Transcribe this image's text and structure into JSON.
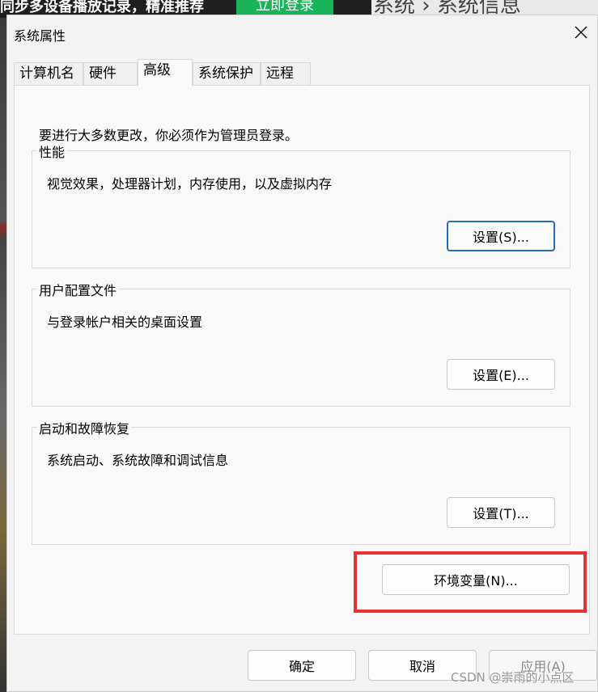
{
  "background": {
    "left_text": "同步多设备播放记录，精准推荐",
    "left_button": "立即登录",
    "right_text": "系统 › 系统信息"
  },
  "dialog": {
    "title": "系统属性",
    "close_icon": "close-icon"
  },
  "tabs": [
    {
      "label": "计算机名",
      "active": false
    },
    {
      "label": "硬件",
      "active": false
    },
    {
      "label": "高级",
      "active": true
    },
    {
      "label": "系统保护",
      "active": false
    },
    {
      "label": "远程",
      "active": false
    }
  ],
  "panel": {
    "notice": "要进行大多数更改，你必须作为管理员登录。",
    "groups": [
      {
        "label": "性能",
        "desc": "视觉效果，处理器计划，内存使用，以及虚拟内存",
        "button": "设置(S)..."
      },
      {
        "label": "用户配置文件",
        "desc": "与登录帐户相关的桌面设置",
        "button": "设置(E)..."
      },
      {
        "label": "启动和故障恢复",
        "desc": "系统启动、系统故障和调试信息",
        "button": "设置(T)..."
      }
    ],
    "env_button": "环境变量(N)..."
  },
  "footer": {
    "ok": "确定",
    "cancel": "取消",
    "apply": "应用(A)"
  },
  "watermark": "CSDN @崇雨的小点区",
  "colors": {
    "highlight": "#e63232",
    "focus": "#2a6ab8",
    "dialog_bg": "#f3f3f3"
  }
}
